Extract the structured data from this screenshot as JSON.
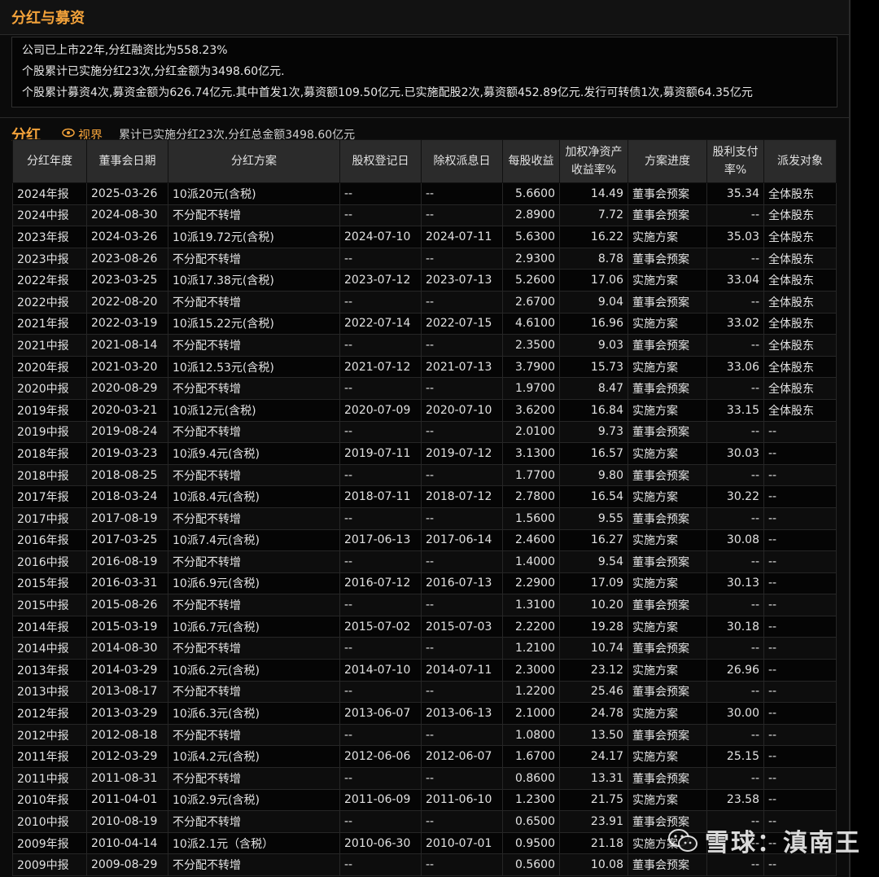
{
  "section1": {
    "title": "分红与募资",
    "lines": [
      "公司已上市22年,分红融资比为558.23%",
      "个股累计已实施分红23次,分红金额为3498.60亿元.",
      "个股累计募资4次,募资金额为626.74亿元.其中首发1次,募资额109.50亿元.已实施配股2次,募资额452.89亿元.发行可转债1次,募资额64.35亿元"
    ]
  },
  "section2": {
    "title": "分红",
    "view_label": "视界",
    "summary": "累计已实施分红23次,分红总金额3498.60亿元"
  },
  "table": {
    "headers": [
      "分红年度",
      "董事会日期",
      "分红方案",
      "股权登记日",
      "除权派息日",
      "每股收益",
      "加权净资产收益率%",
      "方案进度",
      "股利支付率%",
      "派发对象"
    ],
    "rows": [
      [
        "2024年报",
        "2025-03-26",
        "10派20元(含税)",
        "--",
        "--",
        "5.6600",
        "14.49",
        "董事会预案",
        "35.34",
        "全体股东"
      ],
      [
        "2024中报",
        "2024-08-30",
        "不分配不转增",
        "--",
        "--",
        "2.8900",
        "7.72",
        "董事会预案",
        "--",
        "全体股东"
      ],
      [
        "2023年报",
        "2024-03-26",
        "10派19.72元(含税)",
        "2024-07-10",
        "2024-07-11",
        "5.6300",
        "16.22",
        "实施方案",
        "35.03",
        "全体股东"
      ],
      [
        "2023中报",
        "2023-08-26",
        "不分配不转增",
        "--",
        "--",
        "2.9300",
        "8.78",
        "董事会预案",
        "--",
        "全体股东"
      ],
      [
        "2022年报",
        "2023-03-25",
        "10派17.38元(含税)",
        "2023-07-12",
        "2023-07-13",
        "5.2600",
        "17.06",
        "实施方案",
        "33.04",
        "全体股东"
      ],
      [
        "2022中报",
        "2022-08-20",
        "不分配不转增",
        "--",
        "--",
        "2.6700",
        "9.04",
        "董事会预案",
        "--",
        "全体股东"
      ],
      [
        "2021年报",
        "2022-03-19",
        "10派15.22元(含税)",
        "2022-07-14",
        "2022-07-15",
        "4.6100",
        "16.96",
        "实施方案",
        "33.02",
        "全体股东"
      ],
      [
        "2021中报",
        "2021-08-14",
        "不分配不转增",
        "--",
        "--",
        "2.3500",
        "9.03",
        "董事会预案",
        "--",
        "全体股东"
      ],
      [
        "2020年报",
        "2021-03-20",
        "10派12.53元(含税)",
        "2021-07-12",
        "2021-07-13",
        "3.7900",
        "15.73",
        "实施方案",
        "33.06",
        "全体股东"
      ],
      [
        "2020中报",
        "2020-08-29",
        "不分配不转增",
        "--",
        "--",
        "1.9700",
        "8.47",
        "董事会预案",
        "--",
        "全体股东"
      ],
      [
        "2019年报",
        "2020-03-21",
        "10派12元(含税)",
        "2020-07-09",
        "2020-07-10",
        "3.6200",
        "16.84",
        "实施方案",
        "33.15",
        "全体股东"
      ],
      [
        "2019中报",
        "2019-08-24",
        "不分配不转增",
        "--",
        "--",
        "2.0100",
        "9.73",
        "董事会预案",
        "--",
        "--"
      ],
      [
        "2018年报",
        "2019-03-23",
        "10派9.4元(含税)",
        "2019-07-11",
        "2019-07-12",
        "3.1300",
        "16.57",
        "实施方案",
        "30.03",
        "--"
      ],
      [
        "2018中报",
        "2018-08-25",
        "不分配不转增",
        "--",
        "--",
        "1.7700",
        "9.80",
        "董事会预案",
        "--",
        "--"
      ],
      [
        "2017年报",
        "2018-03-24",
        "10派8.4元(含税)",
        "2018-07-11",
        "2018-07-12",
        "2.7800",
        "16.54",
        "实施方案",
        "30.22",
        "--"
      ],
      [
        "2017中报",
        "2017-08-19",
        "不分配不转增",
        "--",
        "--",
        "1.5600",
        "9.55",
        "董事会预案",
        "--",
        "--"
      ],
      [
        "2016年报",
        "2017-03-25",
        "10派7.4元(含税)",
        "2017-06-13",
        "2017-06-14",
        "2.4600",
        "16.27",
        "实施方案",
        "30.08",
        "--"
      ],
      [
        "2016中报",
        "2016-08-19",
        "不分配不转增",
        "--",
        "--",
        "1.4000",
        "9.54",
        "董事会预案",
        "--",
        "--"
      ],
      [
        "2015年报",
        "2016-03-31",
        "10派6.9元(含税)",
        "2016-07-12",
        "2016-07-13",
        "2.2900",
        "17.09",
        "实施方案",
        "30.13",
        "--"
      ],
      [
        "2015中报",
        "2015-08-26",
        "不分配不转增",
        "--",
        "--",
        "1.3100",
        "10.20",
        "董事会预案",
        "--",
        "--"
      ],
      [
        "2014年报",
        "2015-03-19",
        "10派6.7元(含税)",
        "2015-07-02",
        "2015-07-03",
        "2.2200",
        "19.28",
        "实施方案",
        "30.18",
        "--"
      ],
      [
        "2014中报",
        "2014-08-30",
        "不分配不转增",
        "--",
        "--",
        "1.2100",
        "10.74",
        "董事会预案",
        "--",
        "--"
      ],
      [
        "2013年报",
        "2014-03-29",
        "10派6.2元(含税)",
        "2014-07-10",
        "2014-07-11",
        "2.3000",
        "23.12",
        "实施方案",
        "26.96",
        "--"
      ],
      [
        "2013中报",
        "2013-08-17",
        "不分配不转增",
        "--",
        "--",
        "1.2200",
        "25.46",
        "董事会预案",
        "--",
        "--"
      ],
      [
        "2012年报",
        "2013-03-29",
        "10派6.3元(含税)",
        "2013-06-07",
        "2013-06-13",
        "2.1000",
        "24.78",
        "实施方案",
        "30.00",
        "--"
      ],
      [
        "2012中报",
        "2012-08-18",
        "不分配不转增",
        "--",
        "--",
        "1.0800",
        "13.50",
        "董事会预案",
        "--",
        "--"
      ],
      [
        "2011年报",
        "2012-03-29",
        "10派4.2元(含税)",
        "2012-06-06",
        "2012-06-07",
        "1.6700",
        "24.17",
        "实施方案",
        "25.15",
        "--"
      ],
      [
        "2011中报",
        "2011-08-31",
        "不分配不转增",
        "--",
        "--",
        "0.8600",
        "13.31",
        "董事会预案",
        "--",
        "--"
      ],
      [
        "2010年报",
        "2011-04-01",
        "10派2.9元(含税)",
        "2011-06-09",
        "2011-06-10",
        "1.2300",
        "21.75",
        "实施方案",
        "23.58",
        "--"
      ],
      [
        "2010中报",
        "2010-08-19",
        "不分配不转增",
        "--",
        "--",
        "0.6500",
        "23.91",
        "董事会预案",
        "--",
        "--"
      ],
      [
        "2009年报",
        "2010-04-14",
        "10派2.1元（含税）",
        "2010-06-30",
        "2010-07-01",
        "0.9500",
        "21.18",
        "实施方案",
        "--",
        "--"
      ],
      [
        "2009中报",
        "2009-08-29",
        "不分配不转增",
        "--",
        "--",
        "0.5600",
        "10.08",
        "董事会预案",
        "--",
        "--"
      ]
    ]
  },
  "watermark": {
    "text": "雪球：滇南王",
    "icon": "wechat-icon"
  },
  "colors": {
    "accent": "#f3a23a",
    "header_bg": "#2b2b2b",
    "background": "#0b0b0b"
  }
}
